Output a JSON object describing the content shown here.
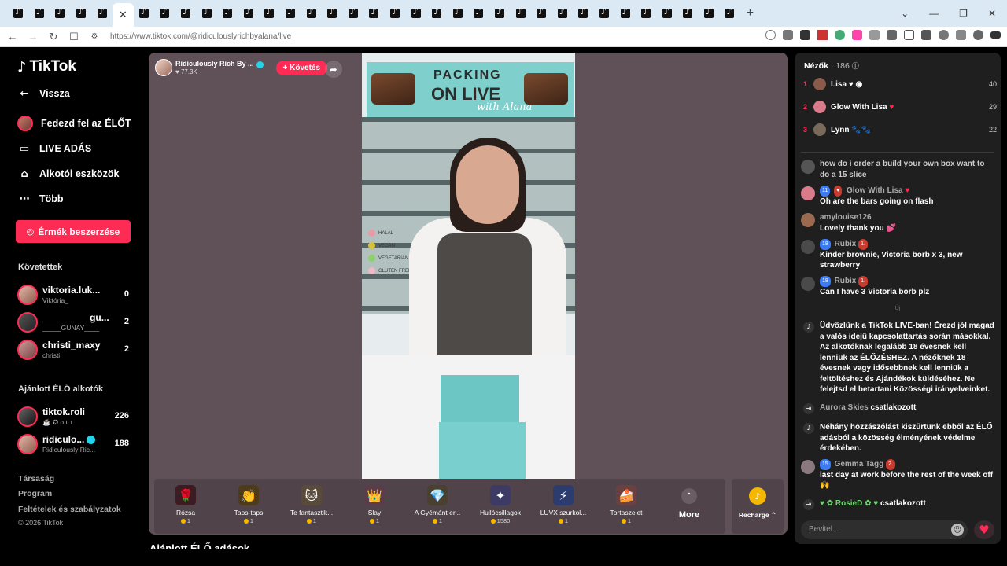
{
  "browser": {
    "tab_count": 35,
    "new_tab_symbol": "+",
    "url": "https://www.tiktok.com/@ridiculouslyrichbyalana/live",
    "window_controls": [
      "⌄",
      "—",
      "❐",
      "✕"
    ]
  },
  "sidebar": {
    "logo": "TikTok",
    "nav": [
      {
        "label": "Vissza",
        "icon": "back-arrow-icon"
      },
      {
        "label": "Fedezd fel az ÉLŐT",
        "icon": "avatar-icon"
      },
      {
        "label": "LIVE ADÁS",
        "icon": "camera-icon"
      },
      {
        "label": "Alkotói eszközök",
        "icon": "house-icon"
      },
      {
        "label": "Több",
        "icon": "ellipsis-icon"
      }
    ],
    "coins_button": "Érmék beszerzése",
    "following_title": "Követettek",
    "following": [
      {
        "name": "viktoria.luk...",
        "sub": "Viktória_",
        "count": "0"
      },
      {
        "name": "_________gu...",
        "sub": "_____GUNAY____",
        "count": "2"
      },
      {
        "name": "christi_maxy",
        "sub": "christi",
        "count": "2"
      }
    ],
    "suggested_title": "Ajánlott ÉLŐ alkotók",
    "suggested": [
      {
        "name": "tiktok.roli",
        "sub": "☕ ✪ o ʟ ɪ",
        "count": "226"
      },
      {
        "name": "ridiculo...",
        "sub": "Ridiculously Ric...",
        "count": "188"
      }
    ],
    "footer": [
      "Társaság",
      "Program",
      "Feltételek és szabályzatok",
      "© 2026 TikTok"
    ]
  },
  "stream": {
    "host_name": "Ridiculously Rich By ...",
    "host_likes": "♥ 77.3K",
    "follow_label": "+ Követés",
    "banner_line1": "PACKING",
    "banner_line2": "ON LIVE",
    "banner_line3": "with Alana",
    "legend": [
      "HALAL",
      "VEGAN",
      "VEGETARIAN",
      "GLUTEN FREE"
    ],
    "below_title": "Ajánlott ÉLŐ adások"
  },
  "gifts": [
    {
      "name": "Rózsa",
      "price": "1",
      "icon": "🌹",
      "color": "#3a1c22"
    },
    {
      "name": "Taps-taps",
      "price": "1",
      "icon": "👏",
      "color": "#4d3b1a"
    },
    {
      "name": "Te fantasztik...",
      "price": "1",
      "icon": "🐱",
      "color": "#5a4a3a"
    },
    {
      "name": "Slay",
      "price": "1",
      "icon": "👑",
      "color": "#5a3c4a"
    },
    {
      "name": "A Gyémánt er...",
      "price": "1",
      "icon": "💎",
      "color": "#4a4030"
    },
    {
      "name": "Hullócsillagok",
      "price": "1580",
      "icon": "✦",
      "color": "#3d3a66"
    },
    {
      "name": "LUVX szurkol...",
      "price": "1",
      "icon": "⚡",
      "color": "#2c3c6e"
    },
    {
      "name": "Tortaszelet",
      "price": "1",
      "icon": "🍰",
      "color": "#6a4040"
    }
  ],
  "more_label": "More",
  "recharge_label": "Recharge ⌃",
  "chat": {
    "viewers_label": "Nézők",
    "viewers_count": "· 186",
    "top": [
      {
        "rank": "1",
        "name": "Lisa ♥ ◉",
        "value": "40",
        "color": "#8a5a4a"
      },
      {
        "rank": "2",
        "name": "Glow With Lisa",
        "value": "29",
        "color": "#d97b8a"
      },
      {
        "rank": "3",
        "name": "Lynn 🐾🐾",
        "value": "22",
        "color": "#7a6a5a"
      }
    ],
    "messages": [
      {
        "user": "",
        "text": "how do i order a build your own box want to do a 15 slice",
        "color": "#555"
      },
      {
        "user": "Glow With Lisa",
        "level": "11",
        "text": "Oh are the bars going on flash",
        "color": "#d97b8a"
      },
      {
        "user": "amylouise126",
        "text": "Lovely thank you 💕",
        "color": "#9a6a50"
      },
      {
        "user": "Rubix",
        "level": "18",
        "fan": "1.",
        "text": "Kinder brownie, Victoria borb x 3, new strawberry",
        "color": "#4a4a4a"
      },
      {
        "user": "Rubix",
        "level": "18",
        "fan": "1.",
        "text": "Can I have 3 Victoria borb plz",
        "color": "#4a4a4a"
      }
    ],
    "new_label": "Új",
    "system1": "Üdvözlünk a TikTok LIVE-ban! Érezd jól magad a valós idejű kapcsolattartás során másokkal. Az alkotóknak legalább 18 évesnek kell lenniük az ÉLŐZÉSHEZ. A nézőknek 18 évesnek vagy idősebbnek kell lenniük a feltöltéshez és Ajándékok küldéséhez. Ne felejtsd el betartani Közösségi irányelveinket.",
    "join1_user": "Aurora Skies",
    "join_text": "csatlakozott",
    "system2": "Néhány hozzászólást kiszűrtünk ebből az ÉLŐ adásból a közösség élményének védelme érdekében.",
    "gemma": {
      "user": "Gemma Tagg",
      "level": "15",
      "fan": "2.",
      "text": "last day at work before the rest of the week off 🙌",
      "color": "#8a7a80"
    },
    "join2_user": "♥ ✿ RosieD ✿ ♥",
    "input_placeholder": "Bevitel..."
  }
}
